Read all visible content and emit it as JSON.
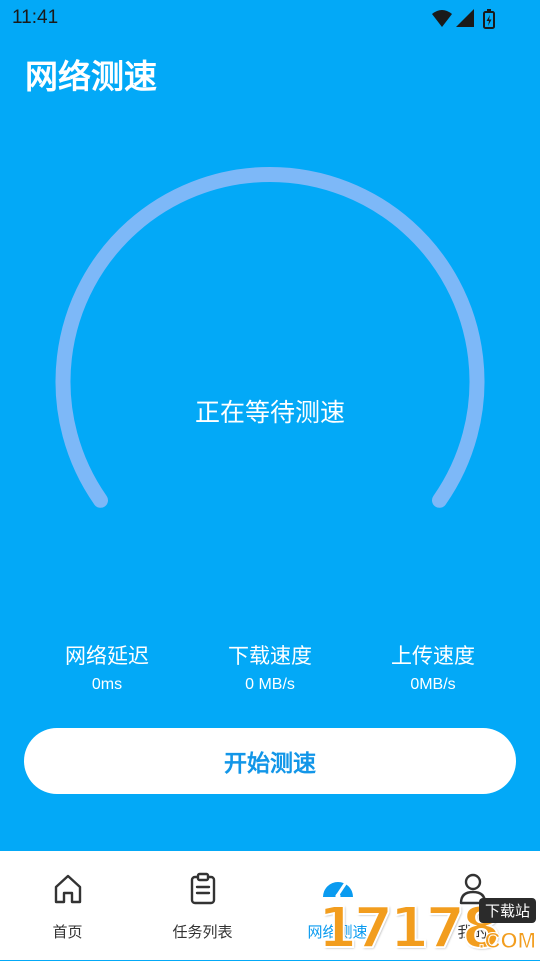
{
  "status_bar": {
    "time": "11:41",
    "icons": [
      "wifi-icon",
      "signal-icon",
      "battery-icon"
    ]
  },
  "page": {
    "title": "网络测速"
  },
  "gauge": {
    "status_text": "正在等待测速",
    "progress": 0,
    "track_color": "#7DB8F8"
  },
  "stats": [
    {
      "label": "网络延迟",
      "value": "0ms"
    },
    {
      "label": "下载速度",
      "value": "0 MB/s"
    },
    {
      "label": "上传速度",
      "value": "0MB/s"
    }
  ],
  "start_button": {
    "label": "开始测速"
  },
  "bottom_nav": {
    "items": [
      {
        "label": "首页",
        "icon": "home-icon",
        "active": false
      },
      {
        "label": "任务列表",
        "icon": "clipboard-icon",
        "active": false
      },
      {
        "label": "网络测速",
        "icon": "speedometer-icon",
        "active": true
      },
      {
        "label": "我的",
        "icon": "person-icon",
        "active": false
      }
    ]
  },
  "watermark": {
    "digits": "17178",
    "tag": "下载站",
    "domain": ".COM"
  },
  "colors": {
    "background": "#03A9F7",
    "accent": "#0A9BF0",
    "button_text": "#1296E8"
  }
}
